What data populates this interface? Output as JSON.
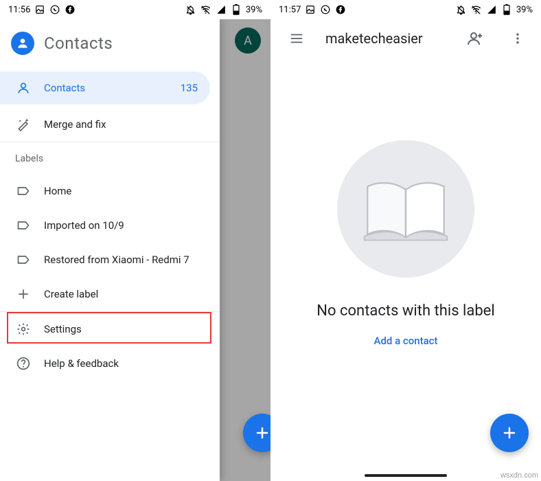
{
  "left": {
    "status": {
      "time": "11:56",
      "battery": "39%"
    },
    "avatar_letter": "A",
    "drawer": {
      "title": "Contacts",
      "primary": {
        "icon": "person-outline-icon",
        "label": "Contacts",
        "count": "135"
      },
      "merge": {
        "icon": "magic-wand-icon",
        "label": "Merge and fix"
      },
      "section_label": "Labels",
      "labels": [
        {
          "icon": "label-outline-icon",
          "label": "Home"
        },
        {
          "icon": "label-outline-icon",
          "label": "Imported on 10/9"
        },
        {
          "icon": "label-outline-icon",
          "label": "Restored from Xiaomi - Redmi 7"
        }
      ],
      "create": {
        "icon": "plus-icon",
        "label": "Create label"
      },
      "settings": {
        "icon": "gear-icon",
        "label": "Settings"
      },
      "help": {
        "icon": "help-icon",
        "label": "Help & feedback"
      }
    }
  },
  "right": {
    "status": {
      "time": "11:57",
      "battery": "39%"
    },
    "appbar": {
      "menu_icon": "menu-icon",
      "title": "maketecheasier",
      "add_person_icon": "person-add-icon",
      "overflow_icon": "more-vert-icon"
    },
    "empty": {
      "icon": "open-book-icon",
      "message": "No contacts with this label",
      "action": "Add a contact"
    },
    "fab_icon": "plus-icon"
  },
  "watermark": "wsxdn.com"
}
